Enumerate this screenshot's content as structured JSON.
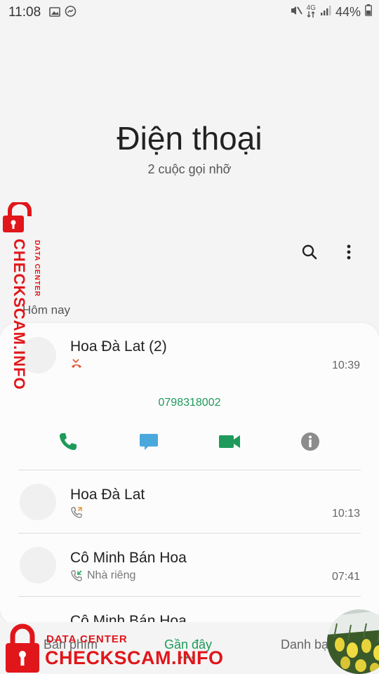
{
  "status_bar": {
    "time": "11:08",
    "network": "4G",
    "battery": "44%",
    "left_icons": [
      "gallery-icon",
      "messenger-icon"
    ],
    "right_icons": [
      "mute-icon",
      "data-arrows-icon",
      "signal-icon",
      "battery-icon"
    ]
  },
  "header": {
    "title": "Điện thoại",
    "subtitle": "2 cuộc gọi nhỡ"
  },
  "toolbar": {
    "icons": [
      "search-icon",
      "more-options-icon"
    ]
  },
  "section": {
    "label": "Hôm nay"
  },
  "calls": [
    {
      "name": "Hoa Đà Lat (2)",
      "type_icon": "missed-call-icon",
      "subtext": "",
      "time": "10:39",
      "expanded": true,
      "number": "0798318002",
      "actions": [
        "phone-call-icon",
        "message-icon",
        "video-call-icon",
        "info-icon"
      ]
    },
    {
      "name": "Hoa Đà Lat",
      "type_icon": "outgoing-call-icon",
      "subtext": "",
      "time": "10:13"
    },
    {
      "name": "Cô Minh Bán Hoa",
      "type_icon": "incoming-call-icon",
      "subtext": "Nhà riêng",
      "time": "07:41"
    },
    {
      "name": "Cô Minh Bán Hoa",
      "type_icon": "",
      "subtext": "",
      "time": ""
    }
  ],
  "bottom_nav": {
    "tabs": [
      "Bàn phím",
      "Gần đây",
      "Danh bạ"
    ],
    "active_index": 1
  },
  "watermark": {
    "brand": "CHECKSCAM.INFO",
    "subtitle": "DATA CENTER"
  },
  "colors": {
    "accent_green": "#1e9a5a",
    "message_blue": "#4aa8dc",
    "missed_red": "#e05a3a",
    "watermark_red": "#e0161b",
    "info_grey": "#8c8c8c"
  }
}
